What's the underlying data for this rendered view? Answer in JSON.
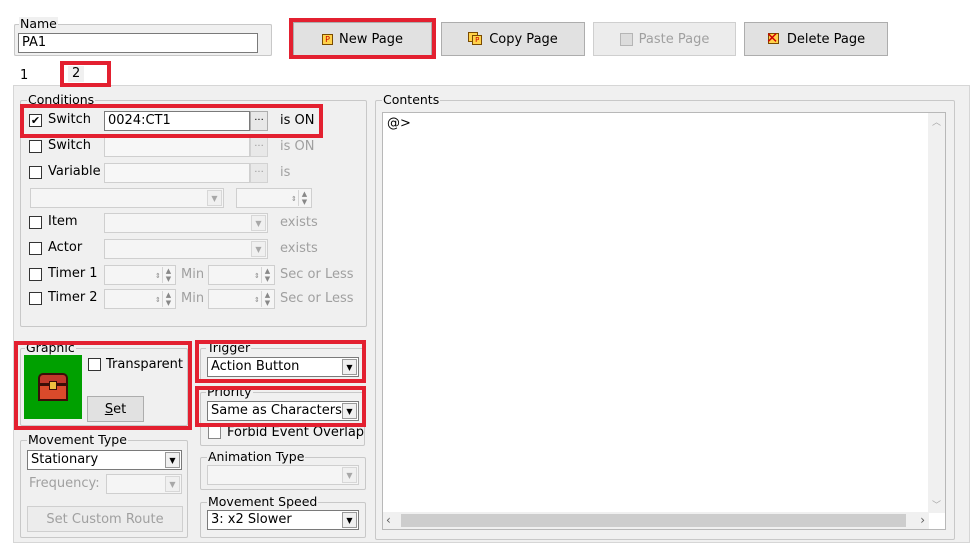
{
  "name": {
    "label": "Name",
    "value": "PA1"
  },
  "toolbar": {
    "new_page": "New Page",
    "copy_page": "Copy Page",
    "paste_page": "Paste Page",
    "delete_page": "Delete Page"
  },
  "tabs": [
    "1",
    "2"
  ],
  "conditions": {
    "title": "Conditions",
    "switch1": {
      "label": "Switch",
      "checked": true,
      "value": "0024:CT1",
      "suffix": "is ON"
    },
    "switch2": {
      "label": "Switch",
      "suffix": "is ON"
    },
    "variable": {
      "label": "Variable",
      "suffix": "is"
    },
    "item": {
      "label": "Item",
      "suffix": "exists"
    },
    "actor": {
      "label": "Actor",
      "suffix": "exists"
    },
    "timer1": {
      "label": "Timer 1",
      "min": "Min",
      "suffix": "Sec or Less"
    },
    "timer2": {
      "label": "Timer 2",
      "min": "Min",
      "suffix": "Sec or Less"
    }
  },
  "graphic": {
    "title": "Graphic",
    "transparent": "Transparent",
    "set": "Set",
    "set_accel": "S",
    "set_rest": "et",
    "bg_color": "#00a000"
  },
  "trigger": {
    "title": "Trigger",
    "value": "Action Button"
  },
  "priority": {
    "title": "Priority",
    "value": "Same as Characters",
    "forbid": "Forbid Event Overlap"
  },
  "movement_type": {
    "title": "Movement Type",
    "value": "Stationary",
    "frequency": "Frequency:",
    "custom_route": "Set Custom Route"
  },
  "animation_type": {
    "title": "Animation Type"
  },
  "movement_speed": {
    "title": "Movement Speed",
    "value": "3: x2 Slower"
  },
  "contents": {
    "title": "Contents",
    "lines": [
      "@>"
    ]
  },
  "colors": {
    "highlight": "#e32030",
    "panel": "#f0f0f0"
  }
}
